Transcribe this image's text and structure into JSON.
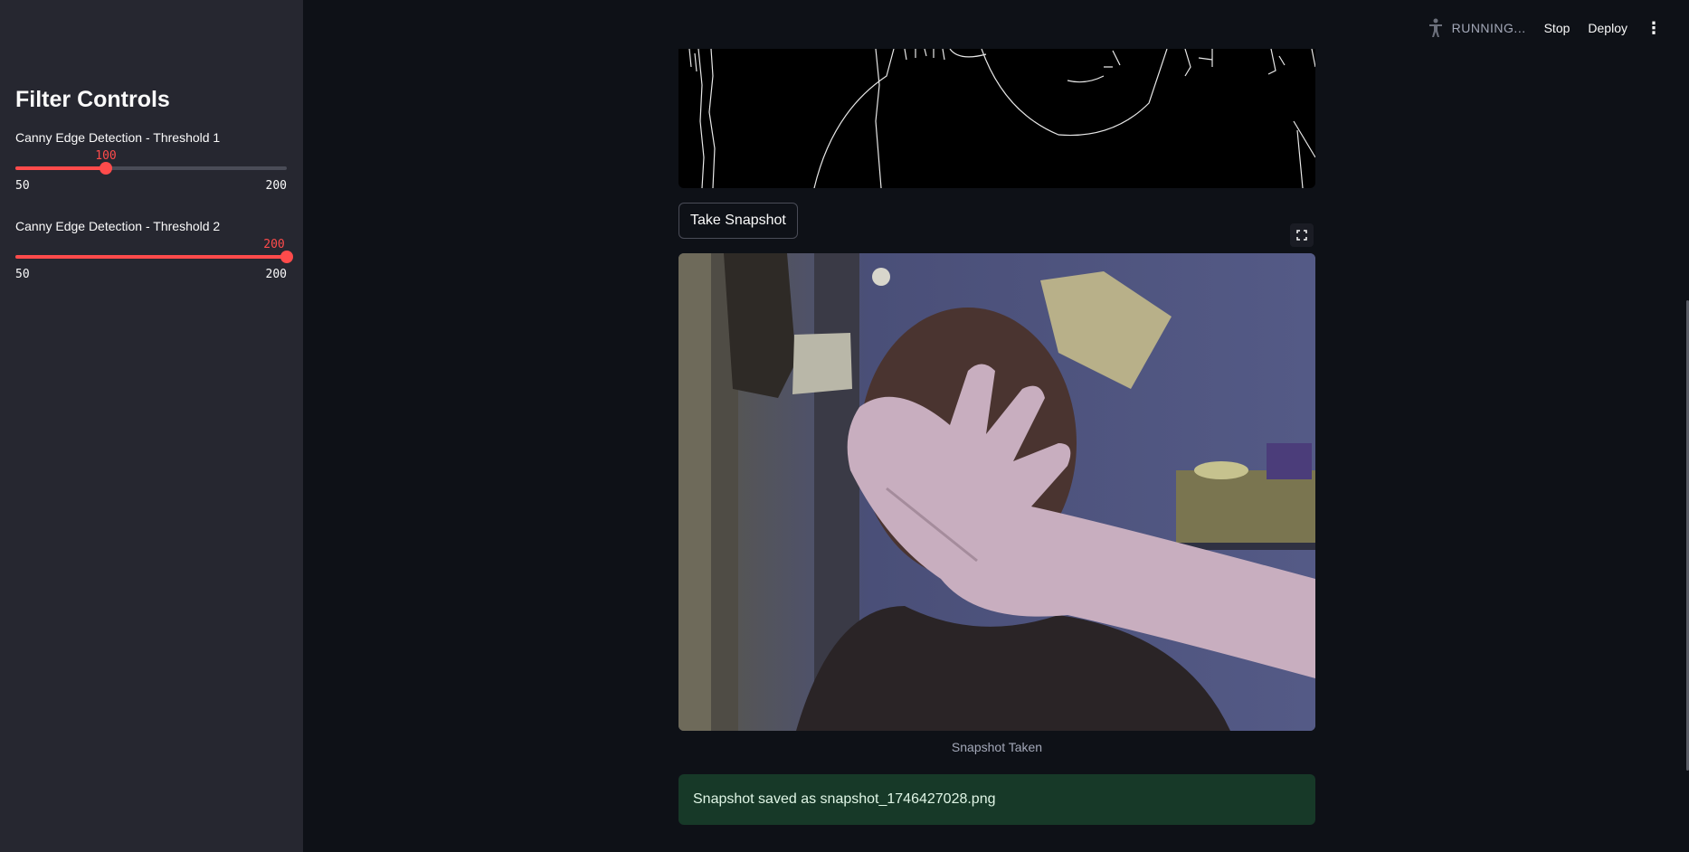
{
  "header": {
    "status": "RUNNING...",
    "stop_label": "Stop",
    "deploy_label": "Deploy",
    "menu_icon": "kebab-menu-icon",
    "status_icon": "running-figure-icon"
  },
  "sidebar": {
    "title": "Filter Controls",
    "sliders": [
      {
        "label": "Canny Edge Detection - Threshold 1",
        "value": "100",
        "min": "50",
        "max": "200",
        "fraction": 0.333
      },
      {
        "label": "Canny Edge Detection - Threshold 2",
        "value": "200",
        "min": "50",
        "max": "200",
        "fraction": 1.0
      }
    ]
  },
  "main": {
    "snapshot_button": "Take Snapshot",
    "fullscreen_icon": "fullscreen-icon",
    "caption": "Snapshot Taken",
    "alert": "Snapshot saved as snapshot_1746427028.png"
  },
  "colors": {
    "accent": "#ff4b4b",
    "background": "#0e1117",
    "sidebar": "#262730",
    "success_bg": "#173928"
  }
}
